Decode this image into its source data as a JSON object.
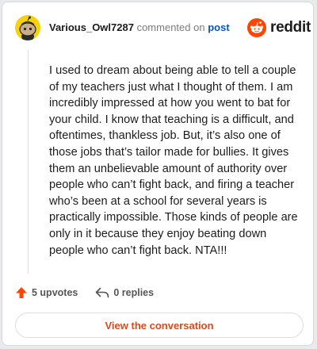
{
  "header": {
    "username": "Various_Owl7287",
    "action_text": "commented on",
    "post_link": "post"
  },
  "brand": {
    "icon": "reddit-snoo-icon",
    "wordmark": "reddit",
    "color": "#ff4500"
  },
  "comment": {
    "body": "I used to dream about being able to tell a couple of my teachers just what I thought of them. I am incredibly impressed at how you went to bat for your child. I know that teaching is a difficult, and oftentimes, thankless job. But, it’s also one of those jobs that’s tailor made for bullies. It gives them an unbelievable amount of authority over people who can’t fight back, and firing a teacher who’s been at a school for several years is practically impossible. Those kinds of people are only in it because they enjoy beating down people who can’t fight back. NTA!!!"
  },
  "stats": {
    "upvotes_icon": "upvote-arrow-icon",
    "upvotes_label": "5 upvotes",
    "replies_icon": "reply-arrow-icon",
    "replies_label": "0 replies"
  },
  "cta": {
    "label": "View the conversation"
  },
  "colors": {
    "accent": "#d84a1b",
    "upvote": "#ff4500",
    "link": "#0a56b8",
    "avatar_bg": "#f5d20b"
  }
}
